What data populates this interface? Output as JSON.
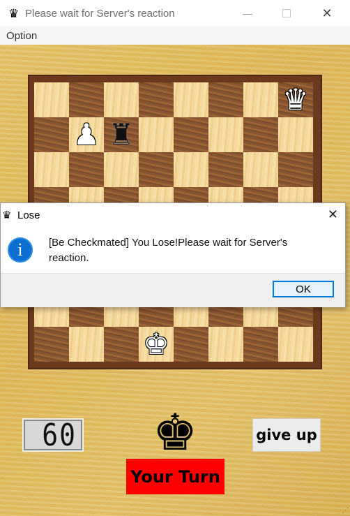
{
  "window": {
    "title": "Please wait for Server's reaction",
    "minimize_glyph": "—",
    "close_glyph": "✕",
    "icon": "queen-icon"
  },
  "menu": {
    "items": [
      {
        "label": "Option"
      }
    ]
  },
  "board": {
    "ranks": [
      [
        null,
        null,
        null,
        null,
        null,
        null,
        null,
        {
          "piece": "queen",
          "color": "white",
          "glyph": "♛"
        }
      ],
      [
        null,
        {
          "piece": "pawn",
          "color": "white",
          "glyph": "♟"
        },
        {
          "piece": "rook",
          "color": "black",
          "glyph": "♜"
        },
        null,
        null,
        null,
        null,
        null
      ],
      [
        null,
        null,
        null,
        null,
        null,
        null,
        null,
        null
      ],
      [
        null,
        null,
        null,
        null,
        null,
        null,
        null,
        null
      ],
      [
        null,
        null,
        null,
        null,
        null,
        null,
        null,
        null
      ],
      [
        null,
        null,
        null,
        null,
        null,
        null,
        null,
        null
      ],
      [
        null,
        null,
        null,
        null,
        null,
        null,
        null,
        null
      ],
      [
        null,
        null,
        null,
        {
          "piece": "king",
          "color": "white",
          "glyph": "♚"
        },
        null,
        null,
        null,
        null
      ]
    ],
    "light_color": "#f4d89c",
    "dark_color": "#8a5631"
  },
  "status": {
    "timer": "60",
    "turn_piece_glyph": "♚",
    "give_up_label": "give up",
    "turn_label": "Your Turn",
    "turn_label_color": "#ff0000"
  },
  "dialog": {
    "title": "Lose",
    "close_glyph": "✕",
    "info_glyph": "i",
    "message": "[Be Checkmated] You Lose!Please wait for Server's reaction.",
    "ok_label": "OK"
  }
}
